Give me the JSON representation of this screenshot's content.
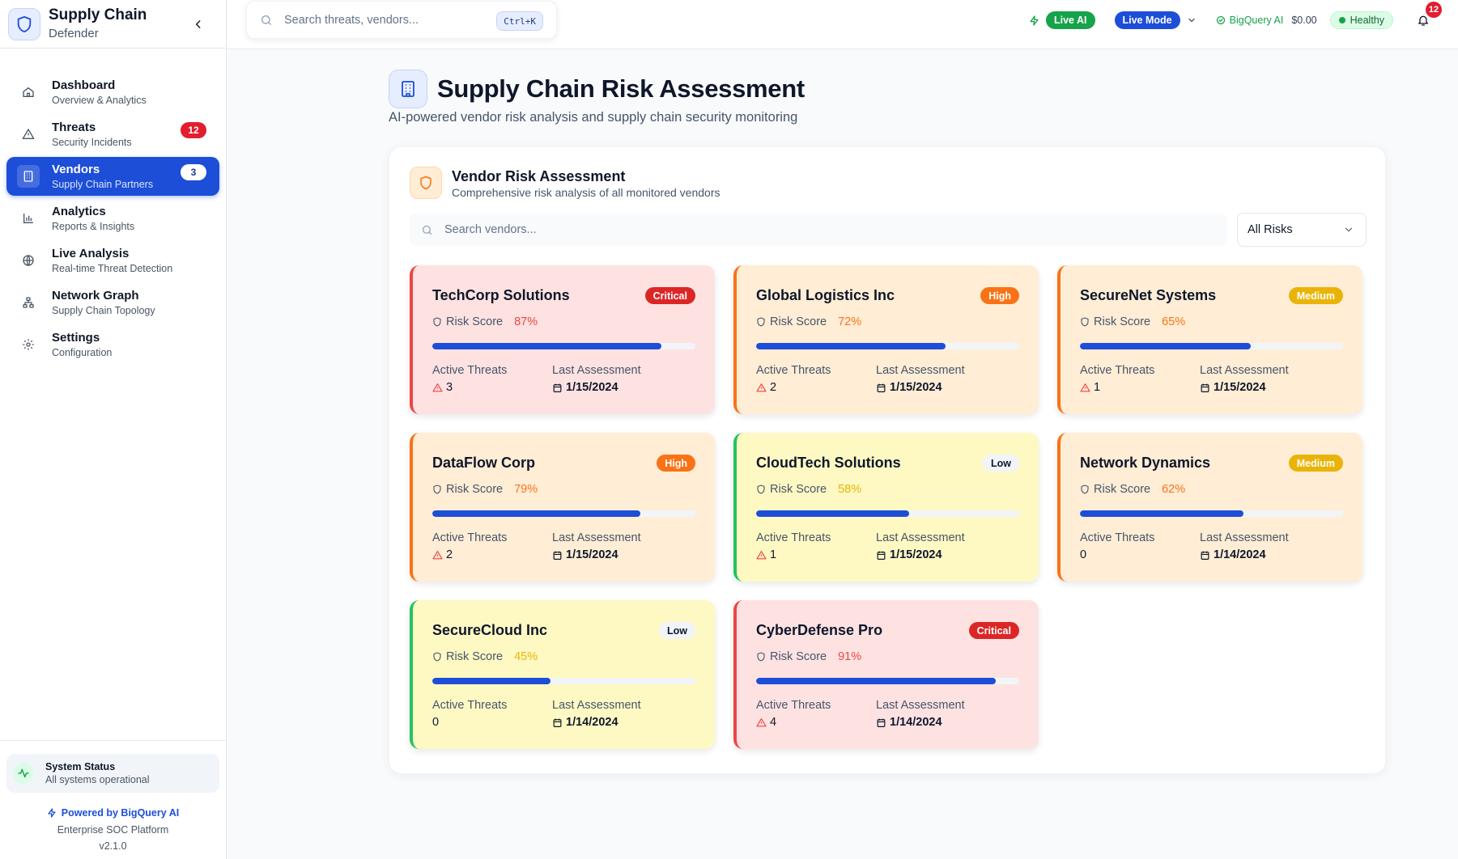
{
  "app": {
    "brand_title": "Supply Chain",
    "brand_subtitle": "Defender"
  },
  "sidebar": {
    "items": [
      {
        "label": "Dashboard",
        "sub": "Overview & Analytics",
        "icon": "home-icon",
        "badge": ""
      },
      {
        "label": "Threats",
        "sub": "Security Incidents",
        "icon": "alert-triangle-icon",
        "badge": "12"
      },
      {
        "label": "Vendors",
        "sub": "Supply Chain Partners",
        "icon": "building-icon",
        "badge": "3",
        "active": true
      },
      {
        "label": "Analytics",
        "sub": "Reports & Insights",
        "icon": "bar-chart-icon",
        "badge": ""
      },
      {
        "label": "Live Analysis",
        "sub": "Real-time Threat Detection",
        "icon": "globe-icon",
        "badge": ""
      },
      {
        "label": "Network Graph",
        "sub": "Supply Chain Topology",
        "icon": "network-icon",
        "badge": ""
      },
      {
        "label": "Settings",
        "sub": "Configuration",
        "icon": "gear-icon",
        "badge": ""
      }
    ],
    "status_title": "System Status",
    "status_sub": "All systems operational",
    "powered_by": "Powered by BigQuery AI",
    "platform": "Enterprise SOC Platform",
    "version": "v2.1.0"
  },
  "topbar": {
    "search_placeholder": "Search threats, vendors...",
    "shortcut": "Ctrl+K",
    "live_ai": "Live AI",
    "live_mode": "Live Mode",
    "bigquery_label": "BigQuery AI",
    "cost": "$0.00",
    "health": "Healthy",
    "notifications": "12"
  },
  "page": {
    "title": "Supply Chain Risk Assessment",
    "subtitle": "AI-powered vendor risk analysis and supply chain security monitoring"
  },
  "panel": {
    "title": "Vendor Risk Assessment",
    "subtitle": "Comprehensive risk analysis of all monitored vendors",
    "search_placeholder": "Search vendors...",
    "filter_value": "All Risks",
    "score_label": "Risk Score",
    "threats_label": "Active Threats",
    "assessment_label": "Last Assessment"
  },
  "vendors": [
    {
      "name": "TechCorp Solutions",
      "level": "Critical",
      "cls": "critical",
      "score": 87,
      "score_text": "87%",
      "threats": "3",
      "threat_icon": true,
      "date": "1/15/2024"
    },
    {
      "name": "Global Logistics Inc",
      "level": "High",
      "cls": "high",
      "score": 72,
      "score_text": "72%",
      "threats": "2",
      "threat_icon": true,
      "date": "1/15/2024"
    },
    {
      "name": "SecureNet Systems",
      "level": "Medium",
      "cls": "medium",
      "score": 65,
      "score_text": "65%",
      "threats": "1",
      "threat_icon": true,
      "date": "1/15/2024"
    },
    {
      "name": "DataFlow Corp",
      "level": "High",
      "cls": "high",
      "score": 79,
      "score_text": "79%",
      "threats": "2",
      "threat_icon": true,
      "date": "1/15/2024"
    },
    {
      "name": "CloudTech Solutions",
      "level": "Low",
      "cls": "low",
      "score": 58,
      "score_text": "58%",
      "threats": "1",
      "threat_icon": true,
      "date": "1/15/2024"
    },
    {
      "name": "Network Dynamics",
      "level": "Medium",
      "cls": "medium",
      "score": 62,
      "score_text": "62%",
      "threats": "0",
      "threat_icon": false,
      "date": "1/14/2024"
    },
    {
      "name": "SecureCloud Inc",
      "level": "Low",
      "cls": "low",
      "score": 45,
      "score_text": "45%",
      "threats": "0",
      "threat_icon": false,
      "date": "1/14/2024"
    },
    {
      "name": "CyberDefense Pro",
      "level": "Critical",
      "cls": "critical",
      "score": 91,
      "score_text": "91%",
      "threats": "4",
      "threat_icon": true,
      "date": "1/14/2024"
    }
  ],
  "colors": {
    "primary": "#1d4ed8",
    "critical": "#ef4444",
    "high": "#f97316",
    "medium": "#eab308",
    "low_border": "#22c55e",
    "healthy": "#16a34a"
  }
}
